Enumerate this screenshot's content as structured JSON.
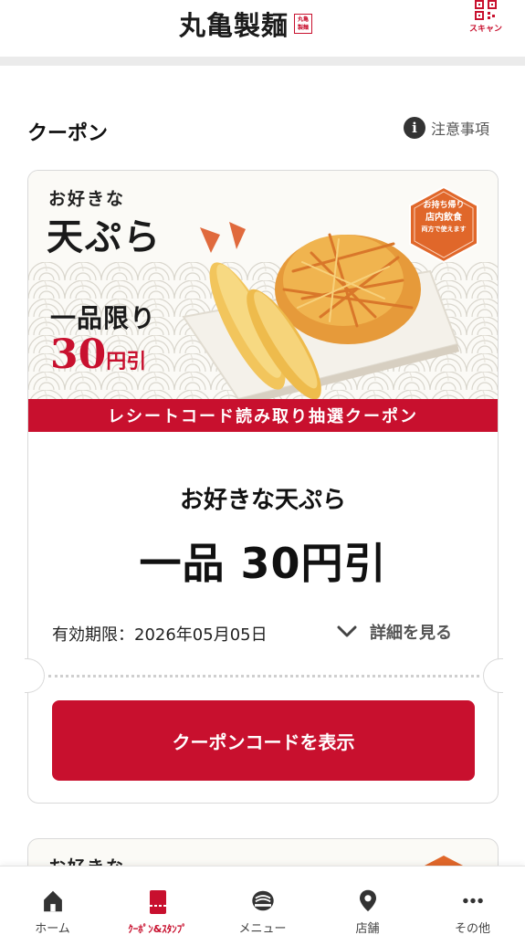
{
  "header": {
    "logo_text": "丸亀製麺",
    "logo_stamp": "丸亀製麺",
    "scan_label": "スキャン"
  },
  "section": {
    "title": "クーポン",
    "notice_label": "注意事項"
  },
  "coupon": {
    "banner": {
      "pre": "お好きな",
      "main": "天ぷら",
      "limit": "一品限り",
      "price_num": "30",
      "price_unit": "円引",
      "badge_lines": [
        "お持ち帰り",
        "店内飲食",
        "両方で使えます"
      ],
      "ribbon": "レシートコード読み取り抽選クーポン"
    },
    "name": "お好きな天ぷら",
    "discount": "一品 30円引",
    "expiry": "有効期限：2026年05月05日",
    "details_label": "詳細を見る",
    "button_label": "クーポンコードを表示"
  },
  "next_coupon": {
    "pre": "お好きな"
  },
  "bottom_nav": {
    "items": [
      {
        "label": "ホーム",
        "icon": "home-icon"
      },
      {
        "label": "ｸｰﾎﾟﾝ&ｽﾀﾝﾌﾟ",
        "icon": "coupon-stamp-icon",
        "active": true
      },
      {
        "label": "メニュー",
        "icon": "menu-bowl-icon"
      },
      {
        "label": "店舗",
        "icon": "location-pin-icon"
      },
      {
        "label": "その他",
        "icon": "more-icon"
      }
    ]
  },
  "colors": {
    "brand_red": "#c8102e",
    "badge_orange": "#e0672a"
  }
}
